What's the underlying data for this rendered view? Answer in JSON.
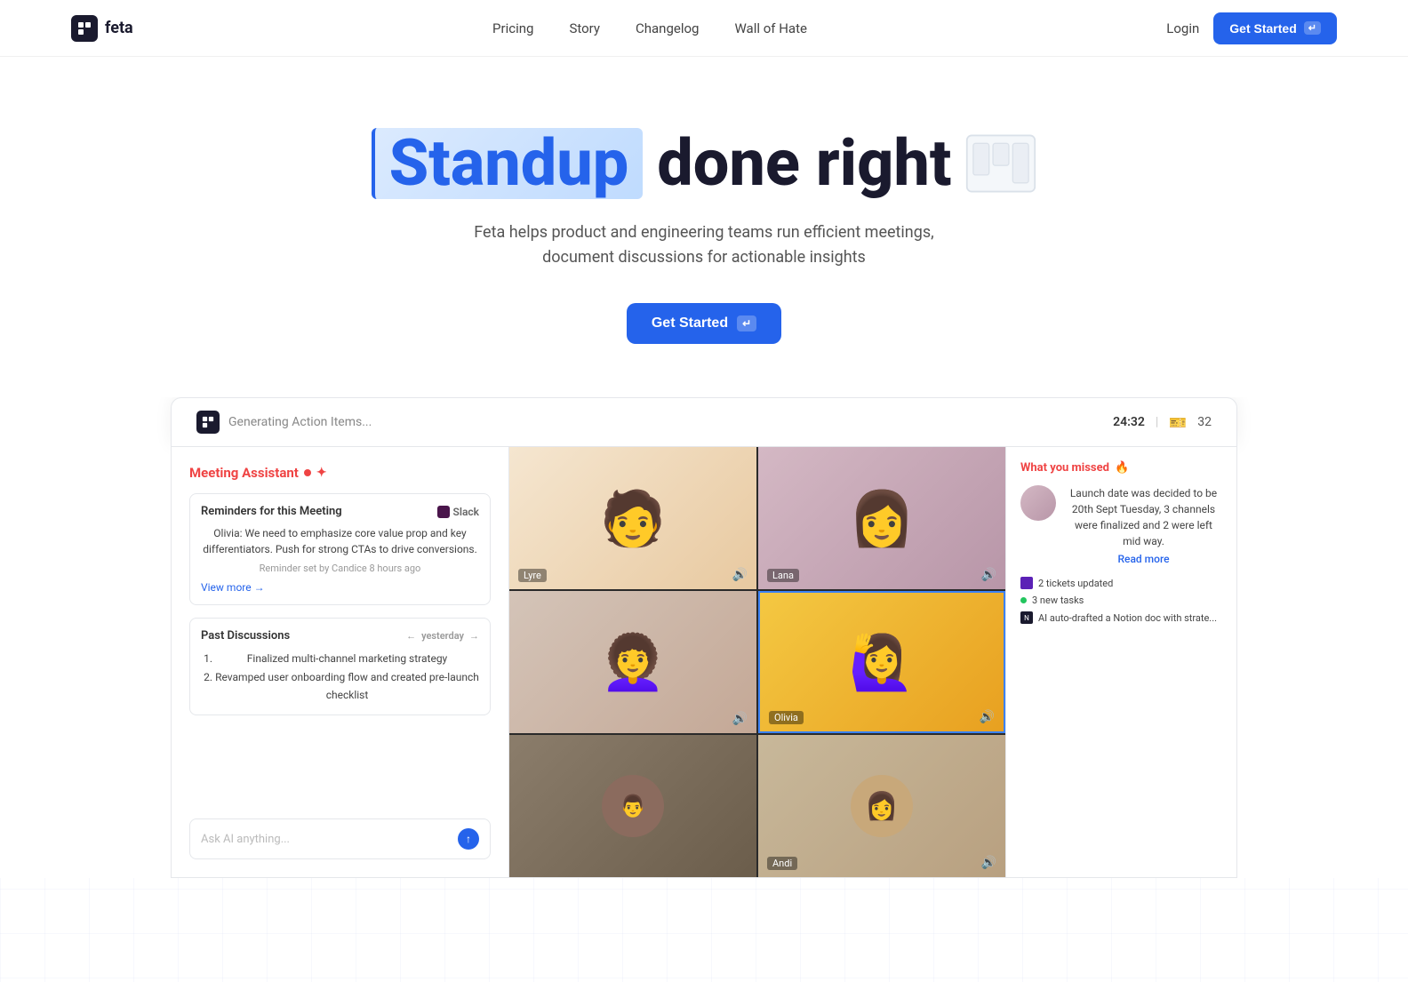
{
  "nav": {
    "logo_text": "feta",
    "logo_icon": "F",
    "links": [
      {
        "label": "Pricing",
        "href": "#"
      },
      {
        "label": "Story",
        "href": "#"
      },
      {
        "label": "Changelog",
        "href": "#"
      },
      {
        "label": "Wall of Hate",
        "href": "#"
      },
      {
        "label": "Login",
        "href": "#"
      }
    ],
    "cta_label": "Get Started",
    "cta_kbd": "↵"
  },
  "hero": {
    "title_highlight": "Standup",
    "title_rest": "done right",
    "subtitle": "Feta helps product and engineering teams run efficient meetings, document discussions for actionable insights",
    "cta_label": "Get Started",
    "cta_kbd": "↵"
  },
  "app_preview": {
    "topbar": {
      "logo": "F",
      "generating_text": "Generating Action Items...",
      "timer": "24:32",
      "ticket_count": "32"
    },
    "left_panel": {
      "header": "Meeting Assistant",
      "reminders_title": "Reminders for this Meeting",
      "slack_label": "Slack",
      "reminder_text": "Olivia: We need to emphasize core value prop and key differentiators. Push for strong CTAs to drive conversions.",
      "reminder_meta": "Reminder set by Candice 8 hours ago",
      "view_more": "View more →",
      "past_disc_title": "Past Discussions",
      "past_disc_date": "yesterday",
      "past_disc_items": [
        "Finalized multi-channel marketing strategy",
        "Revamped user onboarding flow and created pre-launch checklist"
      ],
      "ask_placeholder": "Ask AI anything..."
    },
    "video_cells": [
      {
        "label": "Lyre",
        "person": "lyre"
      },
      {
        "label": "Lana",
        "person": "lana"
      },
      {
        "label": "Olivia",
        "person": "olivia-left"
      },
      {
        "label": "Olivia",
        "person": "olivia-center"
      },
      {
        "label": "",
        "person": "bottom-left"
      },
      {
        "label": "Andi",
        "person": "andi"
      },
      {
        "label": "",
        "person": "bottom-center"
      },
      {
        "label": "",
        "person": "bottom-right"
      }
    ],
    "right_panel": {
      "header": "What you missed",
      "missed_text": "Launch date was decided to be 20th Sept Tuesday, 3 channels were finalized and 2 were left mid way.",
      "read_more": "Read more",
      "items": [
        {
          "type": "linear",
          "text": "2 tickets updated"
        },
        {
          "type": "dot-green",
          "text": "3 new tasks"
        },
        {
          "type": "notion",
          "text": "AI auto-drafted a Notion doc with strate..."
        }
      ]
    }
  }
}
